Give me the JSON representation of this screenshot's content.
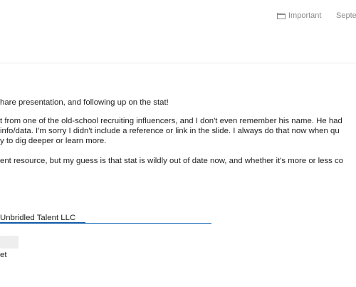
{
  "toolbar": {
    "important_label": "Important",
    "date_fragment": "Septe"
  },
  "message": {
    "lines": [
      "hare presentation, and following up on the stat!",
      "t from one of the old-school recruiting influencers, and I don't even remember his name. He had",
      "info/data. I'm sorry I didn't include a reference or link in the slide. I always do that now when qu",
      "y to dig deeper or learn more.",
      "ent resource, but my guess is that stat is wildly out of date now, and whether it's more or less co"
    ]
  },
  "signature": {
    "company": "Unbridled Talent LLC",
    "tail": "et"
  },
  "colors": {
    "link_blue": "#1f6fbf",
    "muted_gray": "#8a8a8a"
  },
  "icons": {
    "important": "folder-icon"
  }
}
